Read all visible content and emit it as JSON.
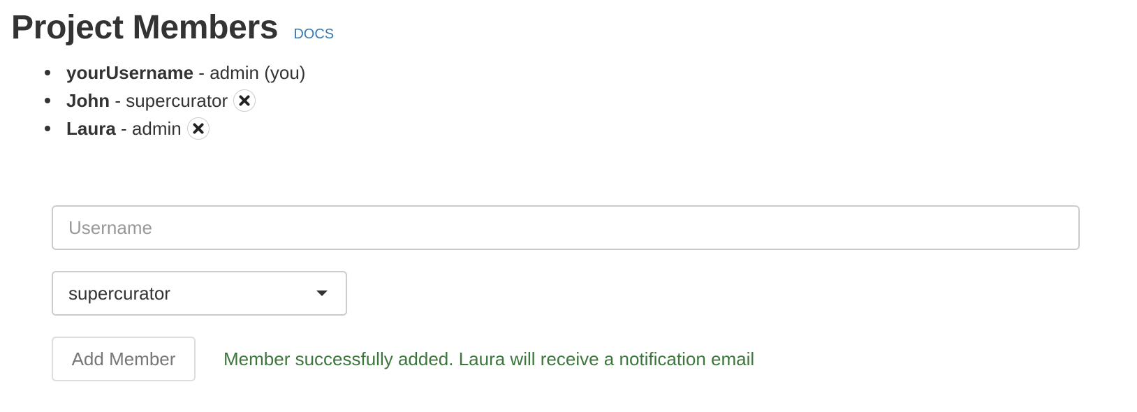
{
  "header": {
    "title": "Project Members",
    "docs_label": "DOCS"
  },
  "members": [
    {
      "name": "yourUsername",
      "separator": " - ",
      "role": "admin (you)",
      "removable": false
    },
    {
      "name": "John",
      "separator": " - ",
      "role": "supercurator",
      "removable": true
    },
    {
      "name": "Laura",
      "separator": " - ",
      "role": "admin",
      "removable": true
    }
  ],
  "form": {
    "username_placeholder": "Username",
    "username_value": "",
    "role_selected": "supercurator",
    "add_button_label": "Add Member",
    "status_message": "Member successfully added. Laura will receive a notification email"
  },
  "icons": {
    "remove": "close-circle-icon",
    "dropdown": "chevron-down-icon"
  },
  "colors": {
    "link": "#337ab7",
    "success": "#3c763d",
    "text": "#333333",
    "border": "#cccccc"
  }
}
